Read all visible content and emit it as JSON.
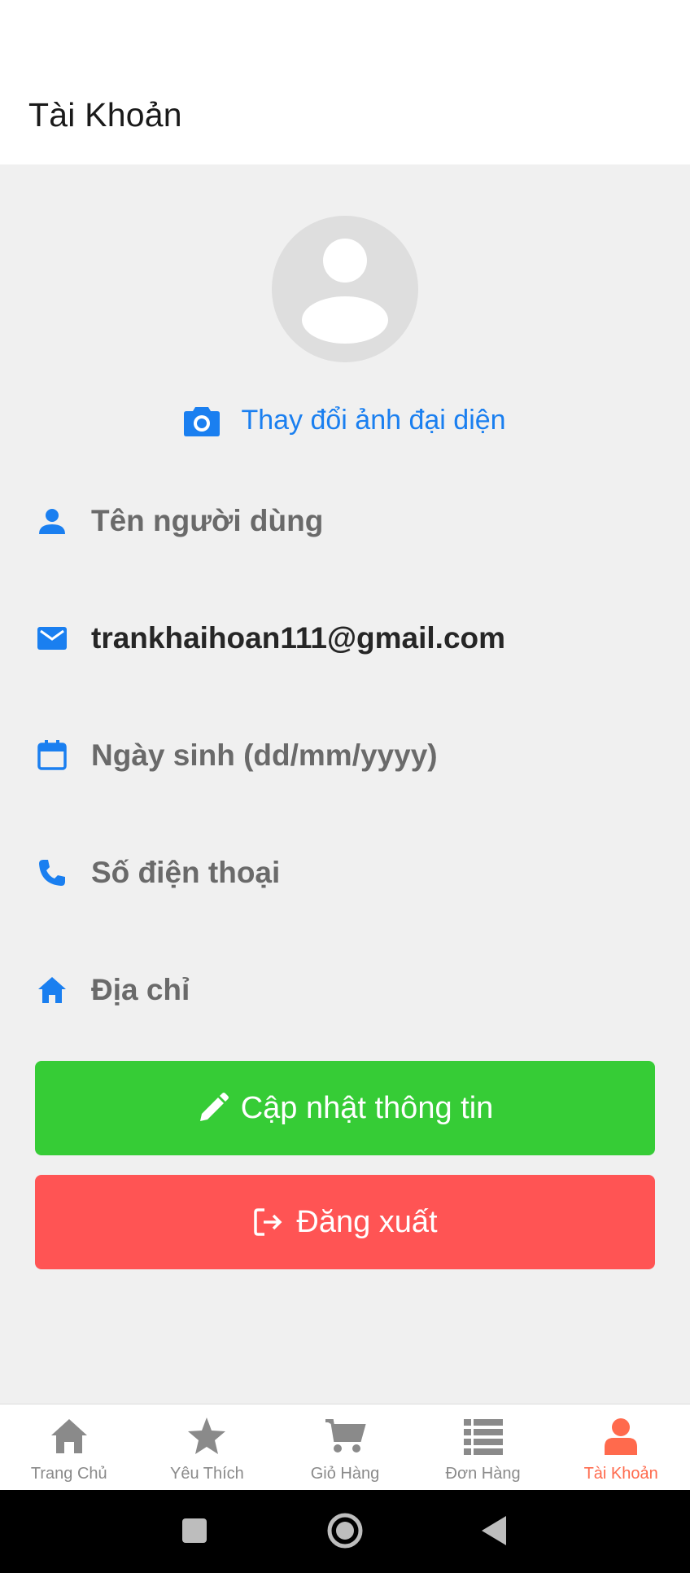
{
  "header": {
    "title": "Tài Khoản"
  },
  "profile": {
    "avatar_icon": "person-placeholder-icon",
    "change_photo_label": "Thay đổi ảnh đại diện"
  },
  "fields": {
    "username": {
      "icon": "person-icon",
      "text": "Tên người dùng"
    },
    "email": {
      "icon": "mail-icon",
      "text": "trankhaihoan111@gmail.com"
    },
    "birthday": {
      "icon": "calendar-icon",
      "text": "Ngày sinh (dd/mm/yyyy)"
    },
    "phone": {
      "icon": "phone-icon",
      "text": "Số điện thoại"
    },
    "address": {
      "icon": "home-icon",
      "text": "Địa chỉ"
    }
  },
  "buttons": {
    "update": {
      "label": "Cập nhật thông tin",
      "color": "#36cc36"
    },
    "logout": {
      "label": "Đăng xuất",
      "color": "#ff5454"
    }
  },
  "tabs": [
    {
      "label": "Trang Chủ",
      "icon": "home-icon",
      "active": false
    },
    {
      "label": "Yêu Thích",
      "icon": "star-icon",
      "active": false
    },
    {
      "label": "Giỏ Hàng",
      "icon": "cart-icon",
      "active": false
    },
    {
      "label": "Đơn Hàng",
      "icon": "list-icon",
      "active": false
    },
    {
      "label": "Tài Khoản",
      "icon": "user-icon",
      "active": true
    }
  ],
  "colors": {
    "accent_blue": "#1a7ff0",
    "active_tab": "#ff6a4d",
    "inactive_tab": "#8a8a8a"
  }
}
